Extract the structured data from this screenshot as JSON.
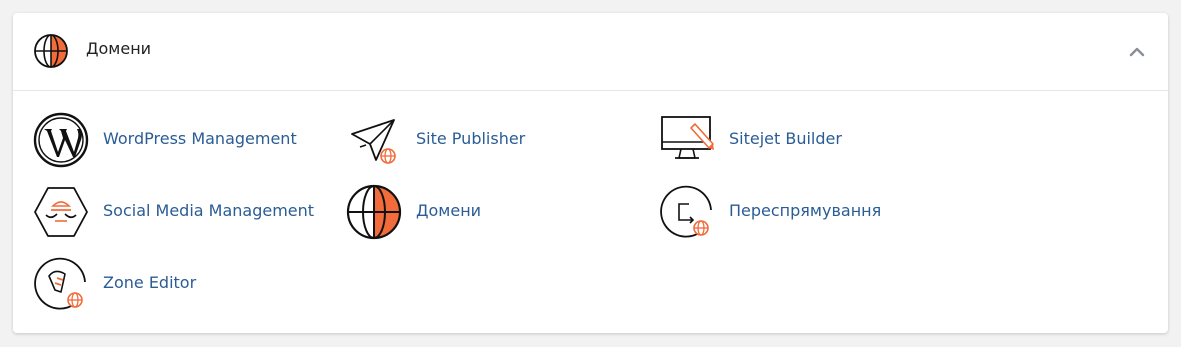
{
  "section": {
    "title": "Домени"
  },
  "apps": [
    {
      "label": "WordPress Management",
      "icon": "wordpress-icon"
    },
    {
      "label": "Site Publisher",
      "icon": "paper-plane-icon"
    },
    {
      "label": "Sitejet Builder",
      "icon": "monitor-pencil-icon"
    },
    {
      "label": "Social Media Management",
      "icon": "social-media-icon"
    },
    {
      "label": "Домени",
      "icon": "globe-icon"
    },
    {
      "label": "Переспрямування",
      "icon": "redirect-icon"
    },
    {
      "label": "Zone Editor",
      "icon": "zone-editor-icon"
    }
  ],
  "colors": {
    "accent": "#f26b3a",
    "link": "#2a5c95",
    "stroke": "#111111"
  }
}
